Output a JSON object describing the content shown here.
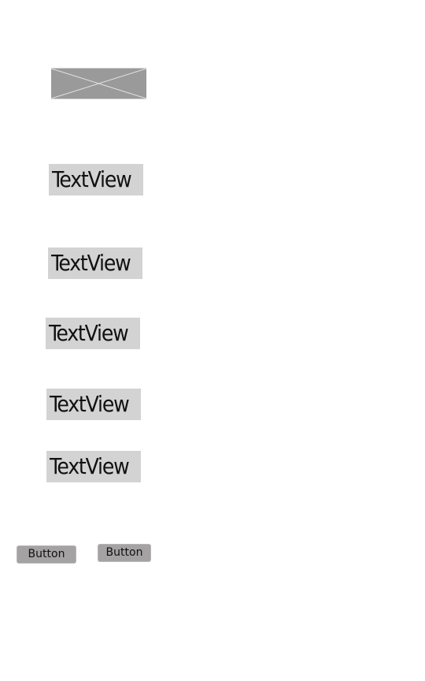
{
  "layout_screen": {
    "image_view": {
      "icon": "image-placeholder-cross-icon",
      "color": "#9a9a9a"
    },
    "text_views": [
      {
        "label": "TextView"
      },
      {
        "label": "TextView"
      },
      {
        "label": "TextView"
      },
      {
        "label": "TextView"
      },
      {
        "label": "TextView"
      }
    ],
    "buttons": [
      {
        "label": "Button"
      },
      {
        "label": "Button"
      }
    ],
    "colors": {
      "text_view_background": "#d3d3d3",
      "button_background": "#a4a2a2",
      "page_background": "#ffffff"
    }
  }
}
